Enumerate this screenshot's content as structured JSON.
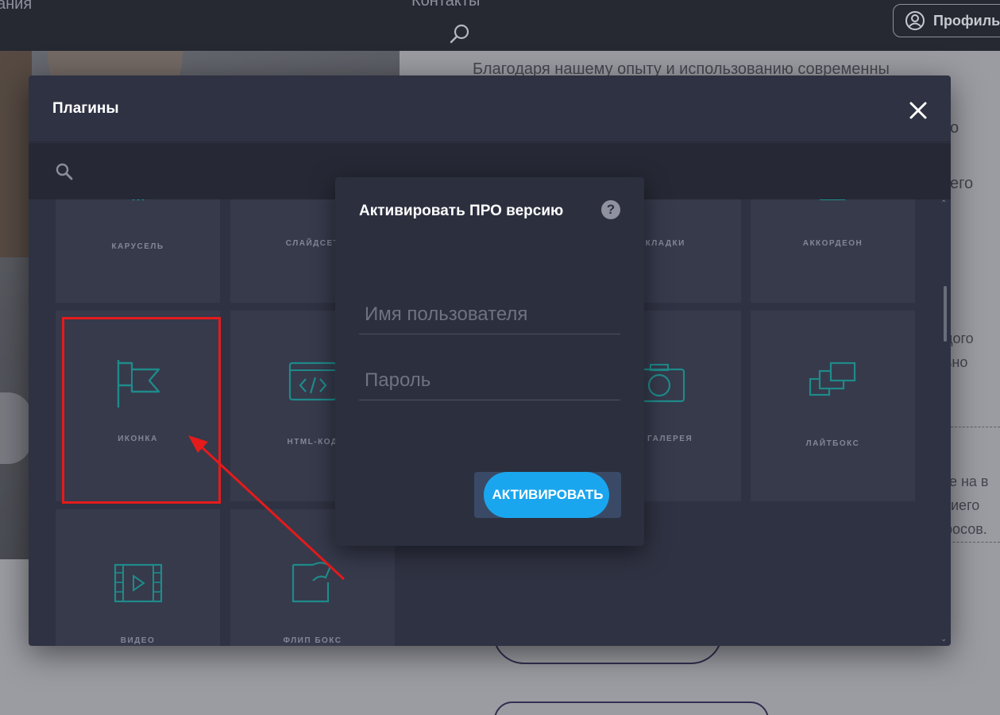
{
  "site": {
    "nav_left": "ания",
    "nav_center": "Контакты",
    "profile_label": "Профиль",
    "body_lines": [
      "Благодаря нашему опыту и использованию современны",
      "о",
      "его",
      "дого",
      "ьно",
      "ые на в",
      "иего",
      "росов."
    ]
  },
  "plugins_modal": {
    "title": "Плагины",
    "search_placeholder": "",
    "tiles": [
      {
        "label": "КАРУСЕЛЬ",
        "icon": "carousel-icon"
      },
      {
        "label": "СЛАЙДСЕТ",
        "icon": "slideshow-icon"
      },
      {
        "label": "ЗАКЛАДКИ",
        "icon": "tabs-icon"
      },
      {
        "label": "АККОРДЕОН",
        "icon": "accordion-icon"
      },
      {
        "label": "ИКОНКА",
        "icon": "flag-icon"
      },
      {
        "label": "HTML-КОД",
        "icon": "html-code-icon"
      },
      {
        "label": "ГАЯ ГАЛЕРЕЯ",
        "icon": "camera-icon"
      },
      {
        "label": "ЛАЙТБОКС",
        "icon": "lightbox-icon"
      },
      {
        "label": "ВИДЕО",
        "icon": "video-icon"
      },
      {
        "label": "ФЛИП БОКС",
        "icon": "flip-box-icon"
      }
    ]
  },
  "pro_dialog": {
    "title": "Активировать ПРО версию",
    "help": "?",
    "username_placeholder": "Имя пользователя",
    "password_placeholder": "Пароль",
    "activate_label": "АКТИВИРОВАТЬ"
  },
  "colors": {
    "accent": "#1aa6ee",
    "highlight": "#e41b1b",
    "icon_teal": "#1f8a8a"
  }
}
